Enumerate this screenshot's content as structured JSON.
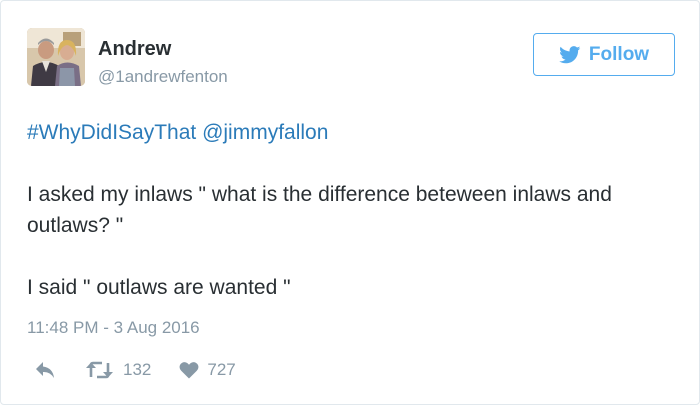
{
  "tweet": {
    "user": {
      "name": "Andrew",
      "handle": "@1andrewfenton",
      "avatar_icon": "profile-photo"
    },
    "follow_button": {
      "label": "Follow",
      "icon": "twitter-bird-icon",
      "color": "#55acee"
    },
    "text": {
      "line1_hashtag": "#WhyDidISayThat",
      "line1_mention": "@jimmyfallon",
      "paragraph2": "I asked my inlaws \" what is the difference beteween inlaws and outlaws? \"",
      "paragraph3": "I said \" outlaws are wanted \""
    },
    "timestamp": "11:48 PM - 3 Aug 2016",
    "actions": {
      "reply_icon": "reply-icon",
      "retweet_icon": "retweet-icon",
      "retweet_count": "132",
      "like_icon": "heart-icon",
      "like_count": "727"
    },
    "colors": {
      "link": "#2b7bb9",
      "muted": "#8899a6",
      "text": "#292f33",
      "border": "#e1e8ed"
    }
  }
}
